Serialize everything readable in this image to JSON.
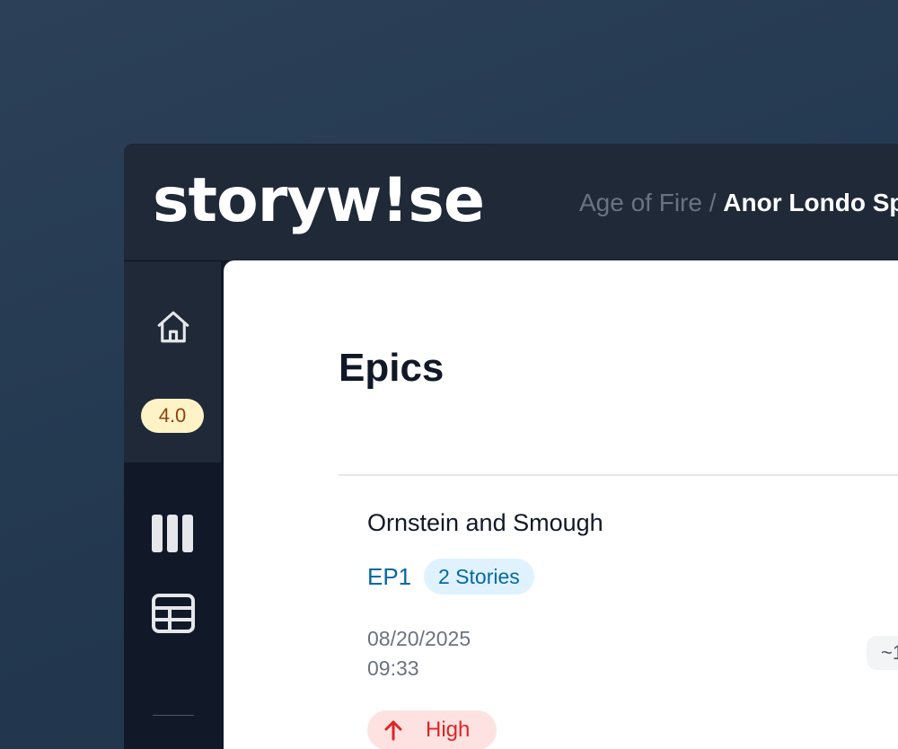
{
  "brand": {
    "logo_text": "storyw!se"
  },
  "breadcrumb": {
    "parent": "Age of Fire",
    "separator": " / ",
    "current": "Anor Londo Sp"
  },
  "sidebar": {
    "items": [
      {
        "name": "home",
        "icon": "home-icon"
      },
      {
        "name": "board",
        "icon": "columns-icon"
      },
      {
        "name": "table",
        "icon": "table-icon"
      }
    ],
    "version_badge": "4.0"
  },
  "main": {
    "title": "Epics",
    "epics": [
      {
        "title": "Ornstein and Smough",
        "id": "EP1",
        "stories_badge": "2 Stories",
        "date": "08/20/2025",
        "time": "09:33",
        "estimate": "~1",
        "priority": {
          "label": "High",
          "icon": "arrow-up-icon"
        }
      }
    ]
  },
  "colors": {
    "background": "#243a51",
    "topbar": "#1f2937",
    "sidebar_bottom": "#111827",
    "version_badge_bg": "#fef3c7",
    "version_badge_text": "#92400e",
    "link_blue": "#0369a1",
    "badge_blue_bg": "#e0f2fe",
    "priority_high_bg": "#fee2e2",
    "priority_high_text": "#dc2626"
  }
}
